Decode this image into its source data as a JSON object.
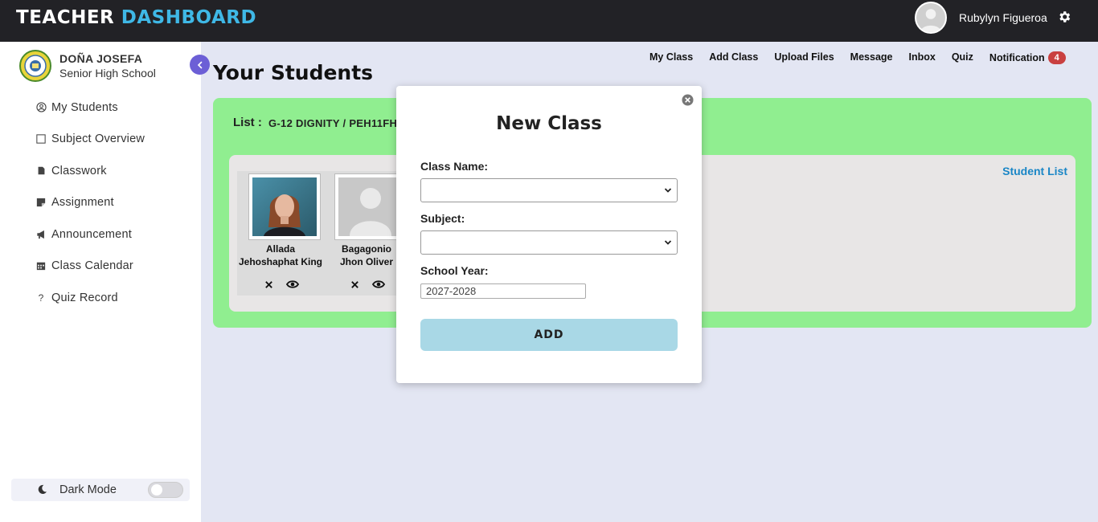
{
  "header": {
    "brand_part1": "TEACHER",
    "brand_part2": "DASHBOARD",
    "user_name": "Rubylyn Figueroa"
  },
  "sidebar": {
    "school_line1": "DOÑA JOSEFA",
    "school_line2": "Senior High School",
    "items": [
      {
        "label": "My Students",
        "icon": "user-circle-icon"
      },
      {
        "label": "Subject Overview",
        "icon": "square-icon"
      },
      {
        "label": "Classwork",
        "icon": "file-icon"
      },
      {
        "label": "Assignment",
        "icon": "sticky-note-icon"
      },
      {
        "label": "Announcement",
        "icon": "megaphone-icon"
      },
      {
        "label": "Class Calendar",
        "icon": "calendar-icon"
      },
      {
        "label": "Quiz Record",
        "icon": "question-icon"
      }
    ],
    "dark_mode_label": "Dark Mode",
    "dark_mode_on": false
  },
  "topnav": {
    "links": [
      "My Class",
      "Add Class",
      "Upload Files",
      "Message",
      "Inbox",
      "Quiz"
    ],
    "notification_label": "Notification",
    "notification_count": "4"
  },
  "main": {
    "page_title": "Your Students",
    "list_label": "List :",
    "list_value": "G-12 DIGNITY /   PEH11FH",
    "student_list_link": "Student List",
    "students": [
      {
        "name_line1": "Allada",
        "name_line2": "Jehoshaphat King"
      },
      {
        "name_line1": "Bagagonio",
        "name_line2": "Jhon Oliver"
      }
    ]
  },
  "modal": {
    "title": "New Class",
    "class_name_label": "Class Name:",
    "class_name_value": "",
    "subject_label": "Subject:",
    "subject_value": "",
    "school_year_label": "School Year:",
    "school_year_value": "2027-2028",
    "add_button": "ADD"
  },
  "colors": {
    "topbar": "#222226",
    "brand_accent": "#3fb8e6",
    "green_panel": "#90ee90",
    "link_blue": "#1a86c6",
    "badge_red": "#c94040",
    "add_button": "#a9d8e6",
    "collapse_button": "#6c5fd6"
  }
}
